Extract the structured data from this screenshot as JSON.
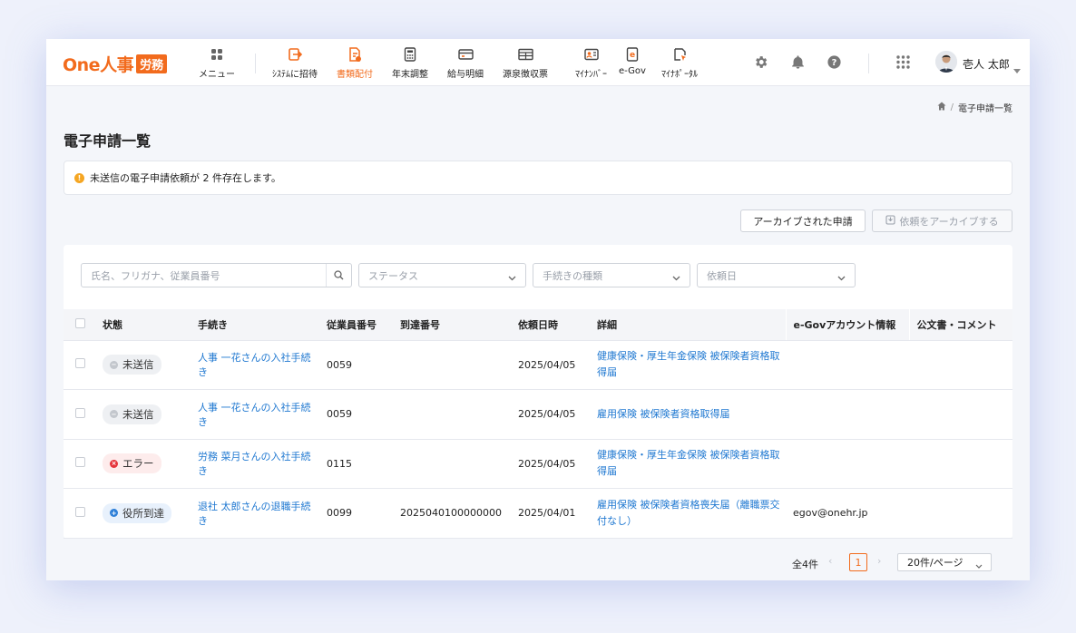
{
  "header": {
    "logo_text": "One人事",
    "logo_badge": "労務",
    "nav": [
      {
        "label": "メニュー",
        "icon": "grid-four-icon"
      },
      {
        "label": "ｼｽﾃﾑに招待",
        "icon": "invite-icon"
      },
      {
        "label": "書類配付",
        "icon": "document-distribute-icon",
        "active": true
      },
      {
        "label": "年末調整",
        "icon": "calculator-icon"
      },
      {
        "label": "給与明細",
        "icon": "payslip-icon"
      },
      {
        "label": "源泉徴収票",
        "icon": "withholding-icon"
      },
      {
        "label": "ﾏｲﾅﾝﾊﾞｰ",
        "icon": "mynumber-card-icon"
      },
      {
        "label": "e-Gov",
        "icon": "egov-icon"
      },
      {
        "label": "ﾏｲﾅﾎﾟｰﾀﾙ",
        "icon": "mynaportal-icon"
      }
    ],
    "user_name": "壱人 太郎",
    "accent": "#f26b1d"
  },
  "breadcrumb": {
    "current": "電子申請一覧"
  },
  "page_title": "電子申請一覧",
  "alert": {
    "text": "未送信の電子申請依頼が 2 件存在します。"
  },
  "actions": {
    "archived_label": "アーカイブされた申請",
    "archive_label": "依頼をアーカイブする"
  },
  "filters": {
    "search_placeholder": "氏名、フリガナ、従業員番号",
    "status_placeholder": "ステータス",
    "procedure_placeholder": "手続きの種類",
    "date_placeholder": "依頼日"
  },
  "table": {
    "columns": [
      "状態",
      "手続き",
      "従業員番号",
      "到達番号",
      "依頼日時",
      "詳細",
      "e-Govアカウント情報",
      "公文書・コメント"
    ],
    "rows": [
      {
        "status": "未送信",
        "status_type": "gray",
        "procedure": "人事 一花さんの入社手続き",
        "employee_no": "0059",
        "arrival_no": "",
        "date": "2025/04/05",
        "detail": "健康保険・厚生年金保険 被保険者資格取得届",
        "egov": "",
        "comment": ""
      },
      {
        "status": "未送信",
        "status_type": "gray",
        "procedure": "人事 一花さんの入社手続き",
        "employee_no": "0059",
        "arrival_no": "",
        "date": "2025/04/05",
        "detail": "雇用保険 被保険者資格取得届",
        "egov": "",
        "comment": ""
      },
      {
        "status": "エラー",
        "status_type": "red",
        "procedure": "労務 菜月さんの入社手続き",
        "employee_no": "0115",
        "arrival_no": "",
        "date": "2025/04/05",
        "detail": "健康保険・厚生年金保険 被保険者資格取得届",
        "egov": "",
        "comment": ""
      },
      {
        "status": "役所到達",
        "status_type": "blue",
        "procedure": "退社 太郎さんの退職手続き",
        "employee_no": "0099",
        "arrival_no": "2025040100000000",
        "date": "2025/04/01",
        "detail": "雇用保険 被保険者資格喪失届（離職票交付なし）",
        "egov": "egov@onehr.jp",
        "comment": ""
      }
    ]
  },
  "pagination": {
    "total": "全4件",
    "current_page": "1",
    "page_size": "20件/ページ"
  }
}
